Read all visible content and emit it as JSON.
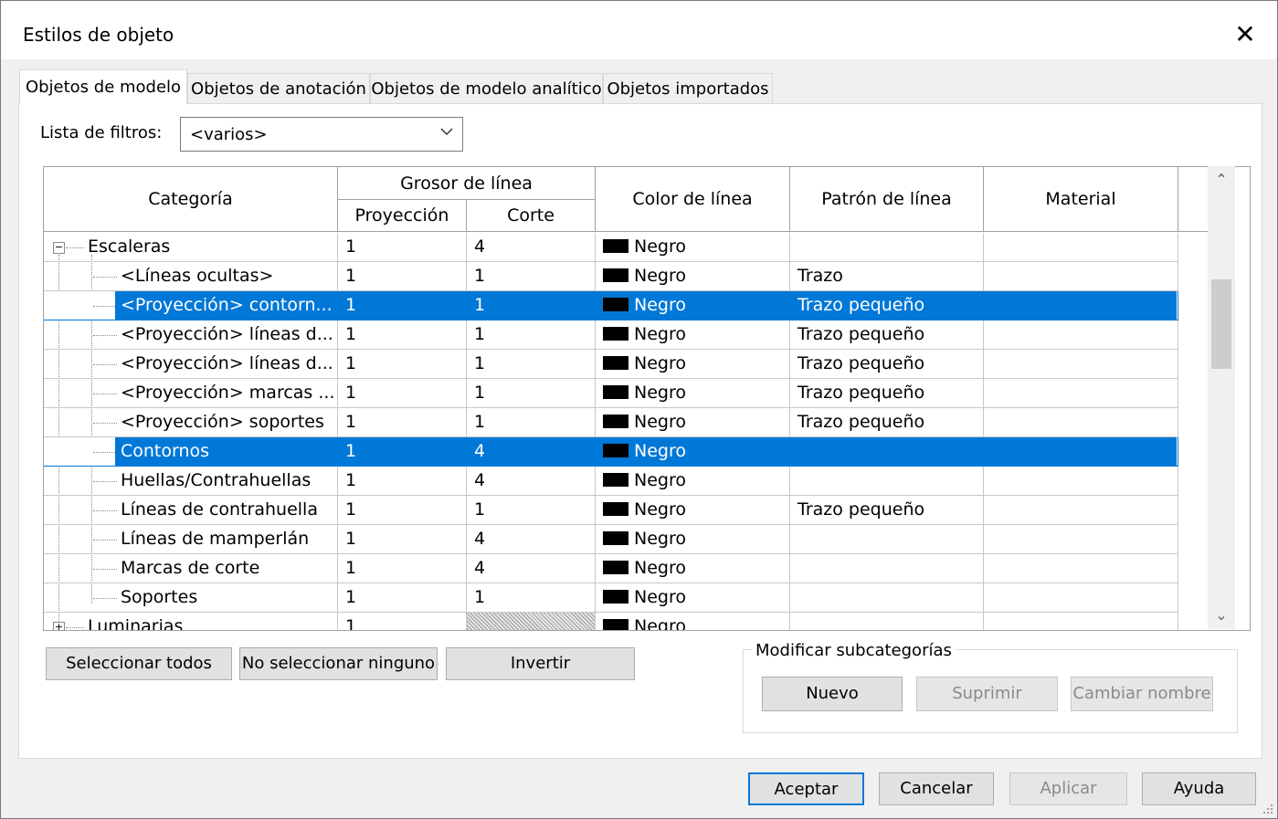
{
  "dialog": {
    "title": "Estilos de objeto",
    "close_glyph": "✕"
  },
  "tabs": [
    {
      "label": "Objetos de modelo",
      "active": true
    },
    {
      "label": "Objetos de anotación",
      "active": false
    },
    {
      "label": "Objetos de modelo analítico",
      "active": false
    },
    {
      "label": "Objetos importados",
      "active": false
    }
  ],
  "filter": {
    "label": "Lista de filtros:",
    "value": "<varios>"
  },
  "grid": {
    "headers": {
      "category": "Categoría",
      "line_weight": "Grosor de línea",
      "projection": "Proyección",
      "cut": "Corte",
      "line_color": "Color de línea",
      "line_pattern": "Patrón de línea",
      "material": "Material"
    },
    "rows": [
      {
        "category": "Escaleras",
        "projection": "1",
        "cut": "4",
        "color": "Negro",
        "pattern": "",
        "material": ""
      },
      {
        "category": "<Líneas ocultas>",
        "projection": "1",
        "cut": "1",
        "color": "Negro",
        "pattern": "Trazo",
        "material": ""
      },
      {
        "category": "<Proyección> contorn...",
        "projection": "1",
        "cut": "1",
        "color": "Negro",
        "pattern": "Trazo pequeño",
        "material": ""
      },
      {
        "category": "<Proyección> líneas d...",
        "projection": "1",
        "cut": "1",
        "color": "Negro",
        "pattern": "Trazo pequeño",
        "material": ""
      },
      {
        "category": "<Proyección> líneas d...",
        "projection": "1",
        "cut": "1",
        "color": "Negro",
        "pattern": "Trazo pequeño",
        "material": ""
      },
      {
        "category": "<Proyección> marcas ...",
        "projection": "1",
        "cut": "1",
        "color": "Negro",
        "pattern": "Trazo pequeño",
        "material": ""
      },
      {
        "category": "<Proyección> soportes",
        "projection": "1",
        "cut": "1",
        "color": "Negro",
        "pattern": "Trazo pequeño",
        "material": ""
      },
      {
        "category": "Contornos",
        "projection": "1",
        "cut": "4",
        "color": "Negro",
        "pattern": "",
        "material": ""
      },
      {
        "category": "Huellas/Contrahuellas",
        "projection": "1",
        "cut": "4",
        "color": "Negro",
        "pattern": "",
        "material": ""
      },
      {
        "category": "Líneas de contrahuella",
        "projection": "1",
        "cut": "1",
        "color": "Negro",
        "pattern": "Trazo pequeño",
        "material": ""
      },
      {
        "category": "Líneas de mamperlán",
        "projection": "1",
        "cut": "4",
        "color": "Negro",
        "pattern": "",
        "material": ""
      },
      {
        "category": "Marcas de corte",
        "projection": "1",
        "cut": "4",
        "color": "Negro",
        "pattern": "",
        "material": ""
      },
      {
        "category": "Soportes",
        "projection": "1",
        "cut": "1",
        "color": "Negro",
        "pattern": "",
        "material": ""
      },
      {
        "category": "Luminarias",
        "projection": "1",
        "cut": "",
        "color": "Negro",
        "pattern": "",
        "material": ""
      }
    ],
    "swatch_color": "#000000",
    "selection_color": "#0078d7"
  },
  "buttons": {
    "select_all": "Seleccionar todos",
    "select_none": "No seleccionar ninguno",
    "invert": "Invertir"
  },
  "subcategories": {
    "legend": "Modificar subcategorías",
    "new": "Nuevo",
    "delete": "Suprimir",
    "rename": "Cambiar nombre"
  },
  "footer": {
    "ok": "Aceptar",
    "cancel": "Cancelar",
    "apply": "Aplicar",
    "help": "Ayuda"
  }
}
